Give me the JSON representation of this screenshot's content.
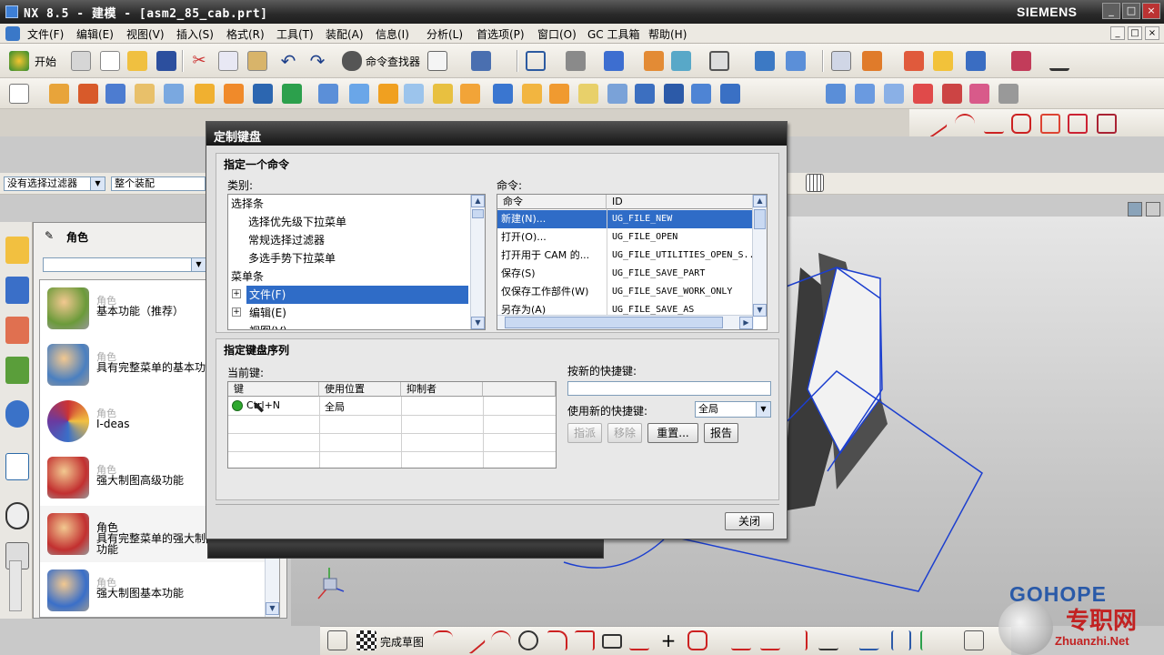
{
  "window": {
    "title": "NX 8.5 - 建模 - [asm2_85_cab.prt]",
    "brand": "SIEMENS",
    "controls": [
      "_",
      "□",
      "×"
    ]
  },
  "menubar": {
    "items": [
      "文件(F)",
      "编辑(E)",
      "视图(V)",
      "插入(S)",
      "格式(R)",
      "工具(T)",
      "装配(A)",
      "信息(I)",
      "分析(L)",
      "首选项(P)",
      "窗口(O)",
      "GC 工具箱",
      "帮助(H)"
    ],
    "mdi_controls": [
      "_",
      "□",
      "×"
    ]
  },
  "toolbar": {
    "start_label": "开始",
    "finder_label": "命令查找器"
  },
  "filterbar": {
    "selection_filter": "没有选择过滤器",
    "scope": "整个装配"
  },
  "role_panel": {
    "title": "角色",
    "dropdown_value": "",
    "roles": [
      {
        "sub": "角色",
        "name": "基本功能（推荐）"
      },
      {
        "sub": "角色",
        "name": "具有完整菜单的基本功能"
      },
      {
        "sub": "角色",
        "name": "I-deas"
      },
      {
        "sub": "角色",
        "name": "强大制图高级功能"
      },
      {
        "sub": "角色",
        "name": "具有完整菜单的强大制图高级",
        "name2": "功能"
      },
      {
        "sub": "角色",
        "name": "强大制图基本功能"
      }
    ]
  },
  "dialog": {
    "title": "定制键盘",
    "assign_group": {
      "title": "指定一个命令",
      "category_label": "类别:",
      "categories": [
        {
          "label": "选择条",
          "indent": 0,
          "expander": ""
        },
        {
          "label": "选择优先级下拉菜单",
          "indent": 1,
          "expander": ""
        },
        {
          "label": "常规选择过滤器",
          "indent": 1,
          "expander": ""
        },
        {
          "label": "多选手势下拉菜单",
          "indent": 1,
          "expander": ""
        },
        {
          "label": "菜单条",
          "indent": 0,
          "expander": ""
        },
        {
          "label": "文件(F)",
          "indent": 1,
          "expander": "+",
          "selected": true
        },
        {
          "label": "编辑(E)",
          "indent": 1,
          "expander": "+"
        },
        {
          "label": "视图(V)",
          "indent": 1,
          "expander": "+"
        }
      ],
      "command_label": "命令:",
      "command_columns": [
        "命令",
        "ID"
      ],
      "commands": [
        {
          "name": "新建(N)...",
          "id": "UG_FILE_NEW",
          "selected": true
        },
        {
          "name": "打开(O)...",
          "id": "UG_FILE_OPEN"
        },
        {
          "name": "打开用于 CAM 的...",
          "id": "UG_FILE_UTILITIES_OPEN_S..."
        },
        {
          "name": "保存(S)",
          "id": "UG_FILE_SAVE_PART"
        },
        {
          "name": "仅保存工作部件(W)",
          "id": "UG_FILE_SAVE_WORK_ONLY"
        },
        {
          "name": "另存为(A)",
          "id": "UG_FILE_SAVE_AS"
        }
      ]
    },
    "key_group": {
      "title": "指定键盘序列",
      "current_keys_label": "当前键:",
      "columns": [
        "键",
        "使用位置",
        "抑制者"
      ],
      "rows": [
        {
          "key": "Ctrl+N",
          "scope": "全局",
          "suppressed_by": ""
        }
      ],
      "new_shortcut_label": "按新的快捷键:",
      "new_shortcut_value": "",
      "use_new_label": "使用新的快捷键:",
      "use_new_value": "全局",
      "buttons": {
        "assign": "指派",
        "remove": "移除",
        "reset": "重置...",
        "report": "报告"
      }
    },
    "close_label": "关闭"
  },
  "bottom_toolbar": {
    "finish_sketch": "完成草图"
  },
  "watermark": {
    "brand": "GOHOPE",
    "cn": "专职网",
    "site": "Zhuanzhi.Net"
  },
  "colors": {
    "selection": "#2f6cc7",
    "title_bar": "#1e1e1e",
    "status_ok": "#2ea82e",
    "model_edge": "#1c3fcf"
  }
}
